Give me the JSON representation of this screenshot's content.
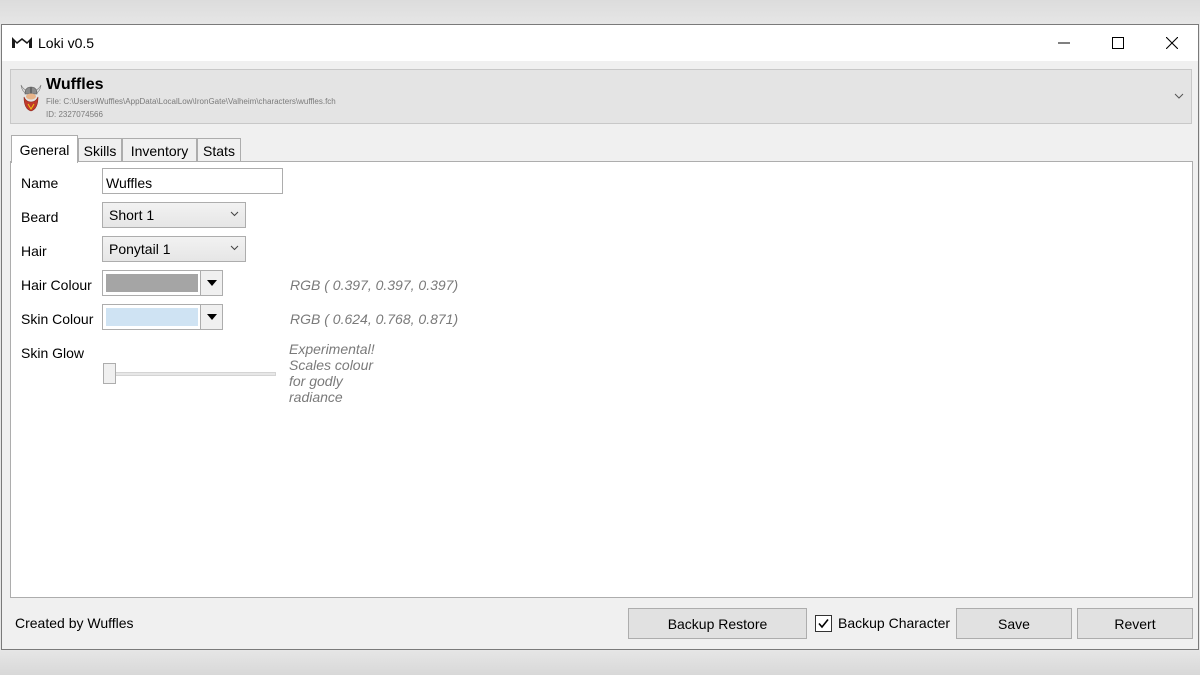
{
  "window": {
    "title": "Loki v0.5"
  },
  "character": {
    "name": "Wuffles",
    "file": "File: C:\\Users\\Wuffles\\AppData\\LocalLow\\IronGate\\Valheim\\characters\\wuffles.fch",
    "id": "ID: 2327074566"
  },
  "tabs": [
    {
      "label": "General",
      "active": true
    },
    {
      "label": "Skills",
      "active": false
    },
    {
      "label": "Inventory",
      "active": false
    },
    {
      "label": "Stats",
      "active": false
    }
  ],
  "general": {
    "name_label": "Name",
    "name_value": "Wuffles",
    "beard_label": "Beard",
    "beard_value": "Short 1",
    "hair_label": "Hair",
    "hair_value": "Ponytail 1",
    "hair_colour_label": "Hair Colour",
    "hair_colour_rgb": "RGB ( 0.397, 0.397, 0.397)",
    "hair_colour_swatch": "#a5a5a5",
    "skin_colour_label": "Skin Colour",
    "skin_colour_rgb": "RGB ( 0.624, 0.768, 0.871)",
    "skin_colour_swatch": "#cfe3f3",
    "skin_glow_label": "Skin Glow",
    "skin_glow_hint": "Experimental! Scales colour for godly radiance",
    "skin_glow_value": 0
  },
  "footer": {
    "credit": "Created by Wuffles",
    "backup_restore": "Backup Restore",
    "backup_character": "Backup Character",
    "backup_character_checked": true,
    "save": "Save",
    "revert": "Revert"
  },
  "icons": {
    "app_logo": "loki-logo-icon",
    "avatar": "viking-avatar-icon",
    "header_expand": "chevron-down-icon",
    "minimize": "minimize-icon",
    "maximize": "maximize-icon",
    "close": "close-icon"
  }
}
